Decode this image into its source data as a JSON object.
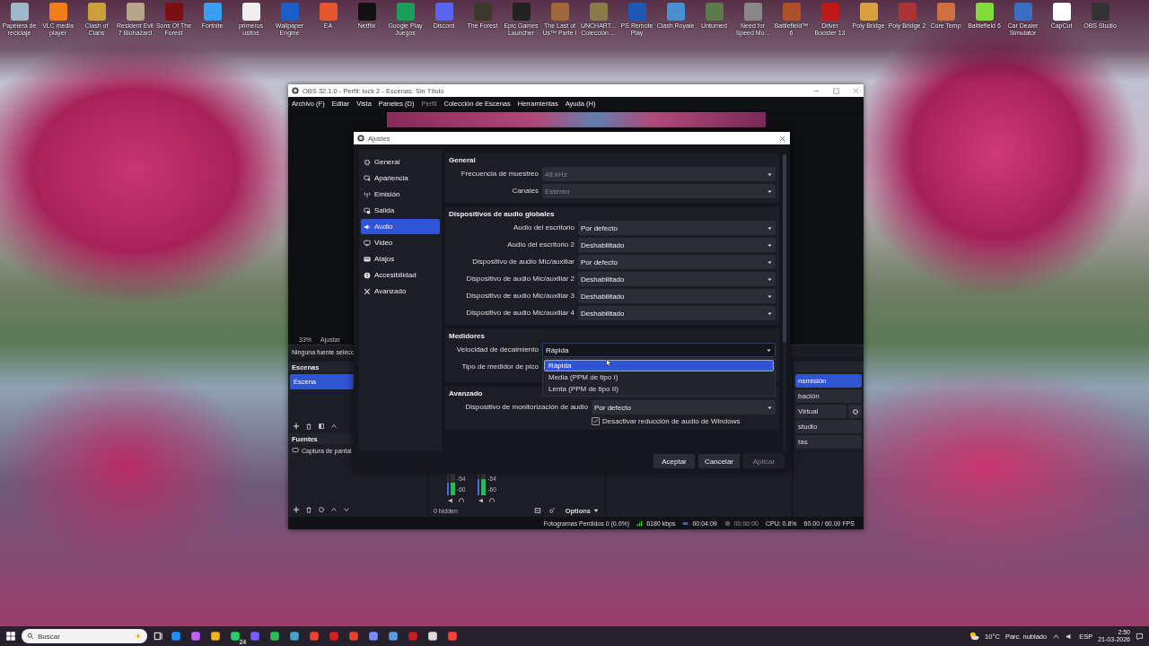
{
  "desktop": {
    "icons": [
      {
        "label": "Papelera de reciclaje"
      },
      {
        "label": "VLC media player"
      },
      {
        "label": "Clash of Clans"
      },
      {
        "label": "Resident Evil 7 Biohazard"
      },
      {
        "label": "Sons Of The Forest"
      },
      {
        "label": "Fortnite"
      },
      {
        "label": "primeros usitos"
      },
      {
        "label": "Wallpaper Engine"
      },
      {
        "label": "EA"
      },
      {
        "label": "Netflix"
      },
      {
        "label": "Google Play Juegos"
      },
      {
        "label": "Discord"
      },
      {
        "label": "The Forest"
      },
      {
        "label": "Epic Games Launcher"
      },
      {
        "label": "The Last of Us™ Parte I"
      },
      {
        "label": "UNCHART... Colección ..."
      },
      {
        "label": "PS Remote Play"
      },
      {
        "label": "Clash Royale"
      },
      {
        "label": "Unturned"
      },
      {
        "label": "Need for Speed Mo..."
      },
      {
        "label": "Battlefield™ 6"
      },
      {
        "label": "Driver Booster 13"
      },
      {
        "label": "Poly Bridge"
      },
      {
        "label": "Poly Bridge 2"
      },
      {
        "label": "Core Temp"
      },
      {
        "label": "Battlefield 6"
      },
      {
        "label": "Car Dealer Simulator"
      },
      {
        "label": "CapCut"
      },
      {
        "label": "OBS Studio"
      }
    ]
  },
  "obs": {
    "title": "OBS 32.1.0 - Perfil: lock 2 - Escenas: Sin Título",
    "menu": [
      {
        "label": "Archivo (F)",
        "disabled": false
      },
      {
        "label": "Editar",
        "disabled": false
      },
      {
        "label": "Vista",
        "disabled": false
      },
      {
        "label": "Paneles (D)",
        "disabled": false
      },
      {
        "label": "Perfil",
        "disabled": true
      },
      {
        "label": "Colección de Escenas",
        "disabled": false
      },
      {
        "label": "Herramientas",
        "disabled": false
      },
      {
        "label": "Ayuda (H)",
        "disabled": false
      }
    ],
    "zoom": {
      "value": "33%",
      "fit": "Ajustar"
    },
    "context_bar": "Ninguna fuente selecc",
    "scenes": {
      "title": "Escenas",
      "items": [
        {
          "label": "Escena",
          "selected": true
        }
      ]
    },
    "sources": {
      "title": "Fuentes",
      "items": [
        "Captura de pantal"
      ]
    },
    "mixer": {
      "channels": [
        {
          "ticks": [
            "-54",
            "-60"
          ],
          "level": 0.6
        },
        {
          "ticks": [
            "-54",
            "-60"
          ],
          "level": 0.75
        }
      ],
      "hidden": "0 hidden",
      "options": "Options"
    },
    "controls": [
      {
        "label": "nsmisión",
        "active": true,
        "settings": false
      },
      {
        "label": "bación",
        "active": false,
        "settings": false
      },
      {
        "label": "Virtual",
        "active": false,
        "settings": true
      },
      {
        "label": "studio",
        "active": false,
        "settings": false
      },
      {
        "label": "tas",
        "active": false,
        "settings": false
      }
    ],
    "status": {
      "dropped": "Fotogramas Perdidos 0 (0.0%)",
      "bitrate": "6180 kbps",
      "stream_time": "00:04:09",
      "rec_time": "00:00:00",
      "cpu": "CPU: 0.8%",
      "fps": "60.00 / 60.00 FPS"
    }
  },
  "settings": {
    "title": "Ajustes",
    "nav": [
      {
        "label": "General",
        "selected": false
      },
      {
        "label": "Apariencia",
        "selected": false
      },
      {
        "label": "Emisión",
        "selected": false
      },
      {
        "label": "Salida",
        "selected": false
      },
      {
        "label": "Audio",
        "selected": true
      },
      {
        "label": "Video",
        "selected": false
      },
      {
        "label": "Atajos",
        "selected": false
      },
      {
        "label": "Accesibilidad",
        "selected": false
      },
      {
        "label": "Avanzado",
        "selected": false
      }
    ],
    "sections": [
      {
        "title": "General",
        "rows": [
          {
            "label": "Frecuencia de muestreo",
            "value": "48 kHz",
            "disabled": true
          },
          {
            "label": "Canales",
            "value": "Estéreo",
            "disabled": true
          }
        ]
      },
      {
        "title": "Dispositivos de audio globales",
        "rows": [
          {
            "label": "Audio del escritorio",
            "value": "Por defecto",
            "disabled": false
          },
          {
            "label": "Audio del escritorio 2",
            "value": "Deshabilitado",
            "disabled": false
          },
          {
            "label": "Dispositivo de audio Mic/auxiliar",
            "value": "Por defecto",
            "disabled": false
          },
          {
            "label": "Dispositivo de audio Mic/auxiliar 2",
            "value": "Deshabilitado",
            "disabled": false
          },
          {
            "label": "Dispositivo de audio Mic/auxiliar 3",
            "value": "Deshabilitado",
            "disabled": false
          },
          {
            "label": "Dispositivo de audio Mic/auxiliar 4",
            "value": "Deshabilitado",
            "disabled": false
          }
        ]
      },
      {
        "title": "Medidores",
        "rows": [
          {
            "label": "Velocidad de decaimiento",
            "value": "Rápida",
            "disabled": false,
            "open": true
          },
          {
            "label": "Tipo de medidor de pico"
          }
        ]
      },
      {
        "title": "Avanzado",
        "rows": [
          {
            "label": "Dispositivo de monitorización de audio",
            "value": "Por defecto",
            "disabled": false
          }
        ],
        "checkbox": {
          "label": "Desactivar reducción de audio de Windows",
          "checked": true
        }
      }
    ],
    "dropdown": [
      {
        "label": "Rápida",
        "selected": true
      },
      {
        "label": "Media (PPM de tipo I)",
        "selected": false
      },
      {
        "label": "Lenta (PPM de tipo II)",
        "selected": false
      }
    ],
    "buttons": [
      {
        "label": "Aceptar",
        "disabled": false
      },
      {
        "label": "Cancelar",
        "disabled": false
      },
      {
        "label": "Aplicar",
        "disabled": true
      }
    ]
  },
  "taskbar": {
    "search": "Buscar",
    "badge": "24",
    "temperature": "10°C",
    "weather": "Parc. nublado",
    "language": "ESP",
    "time": "2:50",
    "date": "21-03-2026"
  }
}
